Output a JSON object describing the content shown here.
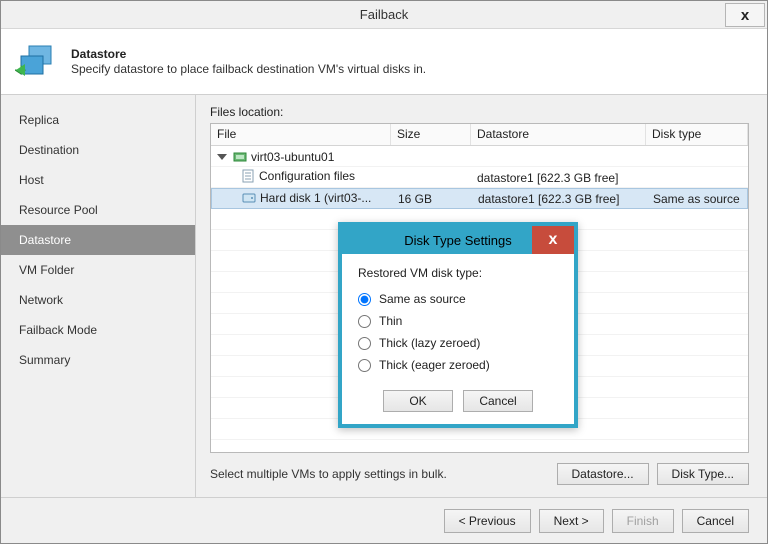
{
  "titlebar": {
    "title": "Failback",
    "close": "x"
  },
  "header": {
    "step_title": "Datastore",
    "step_desc": "Specify datastore to place failback destination VM's virtual disks in."
  },
  "sidebar": {
    "items": [
      {
        "label": "Replica"
      },
      {
        "label": "Destination"
      },
      {
        "label": "Host"
      },
      {
        "label": "Resource Pool"
      },
      {
        "label": "Datastore"
      },
      {
        "label": "VM Folder"
      },
      {
        "label": "Network"
      },
      {
        "label": "Failback Mode"
      },
      {
        "label": "Summary"
      }
    ],
    "active_index": 4
  },
  "main": {
    "list_label": "Files location:",
    "columns": {
      "file": "File",
      "size": "Size",
      "datastore": "Datastore",
      "disk_type": "Disk type"
    },
    "rows": [
      {
        "file": "virt03-ubuntu01",
        "size": "",
        "datastore": "",
        "disk_type": "",
        "kind": "vm",
        "level": 0
      },
      {
        "file": "Configuration files",
        "size": "",
        "datastore": "datastore1 [622.3 GB free]",
        "disk_type": "",
        "kind": "cfg",
        "level": 1
      },
      {
        "file": "Hard disk 1 (virt03-...",
        "size": "16 GB",
        "datastore": "datastore1 [622.3 GB free]",
        "disk_type": "Same as source",
        "kind": "disk",
        "level": 1,
        "selected": true
      }
    ],
    "bulk_text": "Select multiple VMs to apply settings in bulk.",
    "btn_datastore": "Datastore...",
    "btn_disktype": "Disk Type..."
  },
  "dialog": {
    "title": "Disk Type Settings",
    "group_label": "Restored VM disk type:",
    "options": [
      {
        "label": "Same as source",
        "checked": true
      },
      {
        "label": "Thin"
      },
      {
        "label": "Thick (lazy zeroed)"
      },
      {
        "label": "Thick (eager zeroed)"
      }
    ],
    "ok": "OK",
    "cancel": "Cancel",
    "close": "x"
  },
  "footer": {
    "prev": "< Previous",
    "next": "Next >",
    "finish": "Finish",
    "cancel": "Cancel"
  }
}
